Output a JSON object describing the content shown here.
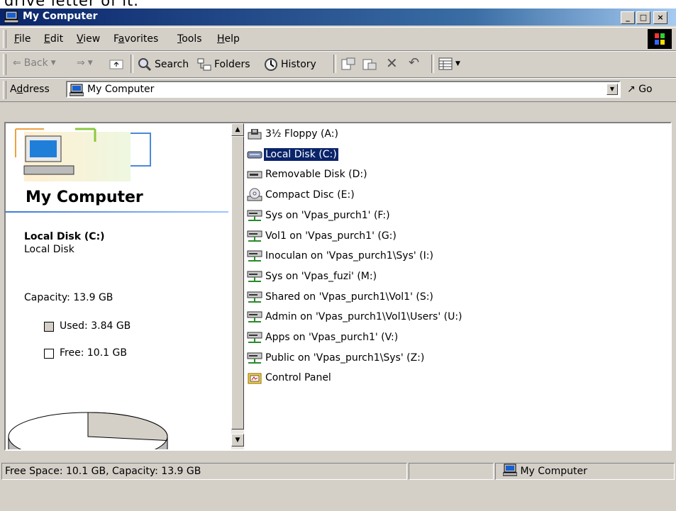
{
  "top_caption": "drive letter of it.",
  "window": {
    "title": "My Computer",
    "controls": [
      "_",
      "□",
      "×"
    ]
  },
  "menu": [
    {
      "label": "File",
      "key": "F",
      "rest": "ile"
    },
    {
      "label": "Edit",
      "key": "E",
      "rest": "dit"
    },
    {
      "label": "View",
      "key": "V",
      "rest": "iew"
    },
    {
      "label": "Favorites",
      "pre": "F",
      "key": "a",
      "rest": "vorites"
    },
    {
      "label": "Tools",
      "key": "T",
      "rest": "ools"
    },
    {
      "label": "Help",
      "key": "H",
      "rest": "elp"
    }
  ],
  "toolbar": {
    "back": "Back",
    "search": "Search",
    "folders": "Folders",
    "history": "History"
  },
  "address": {
    "label_pre": "A",
    "label_key": "d",
    "label_rest": "dress",
    "value": "My Computer",
    "go": "Go"
  },
  "left_pane": {
    "title": "My Computer",
    "selected_name": "Local Disk (C:)",
    "selected_type": "Local Disk",
    "capacity": "Capacity: 13.9 GB",
    "used": "Used: 3.84 GB",
    "free": "Free: 10.1 GB",
    "used_fraction": 0.276,
    "used_color": "#d4d0c8",
    "free_color": "#ffffff"
  },
  "items": [
    {
      "label": "3½ Floppy (A:)",
      "icon": "floppy-drive-icon"
    },
    {
      "label": "Local Disk (C:)",
      "icon": "hard-disk-icon",
      "selected": true
    },
    {
      "label": "Removable Disk (D:)",
      "icon": "removable-disk-icon"
    },
    {
      "label": "Compact Disc (E:)",
      "icon": "cd-drive-icon"
    },
    {
      "label": "Sys on 'Vpas_purch1' (F:)",
      "icon": "network-drive-icon"
    },
    {
      "label": "Vol1 on 'Vpas_purch1' (G:)",
      "icon": "network-drive-icon"
    },
    {
      "label": "Inoculan on 'Vpas_purch1\\Sys' (I:)",
      "icon": "network-drive-icon"
    },
    {
      "label": "Sys on 'Vpas_fuzi' (M:)",
      "icon": "network-drive-icon"
    },
    {
      "label": "Shared on 'Vpas_purch1\\Vol1' (S:)",
      "icon": "network-drive-icon"
    },
    {
      "label": "Admin on 'Vpas_purch1\\Vol1\\Users' (U:)",
      "icon": "network-drive-icon"
    },
    {
      "label": "Apps on 'Vpas_purch1' (V:)",
      "icon": "network-drive-icon"
    },
    {
      "label": "Public on 'Vpas_purch1\\Sys' (Z:)",
      "icon": "network-drive-icon"
    },
    {
      "label": "Control Panel",
      "icon": "control-panel-icon"
    }
  ],
  "status": {
    "left": "Free Space: 10.1 GB, Capacity: 13.9 GB",
    "right": "My Computer"
  }
}
